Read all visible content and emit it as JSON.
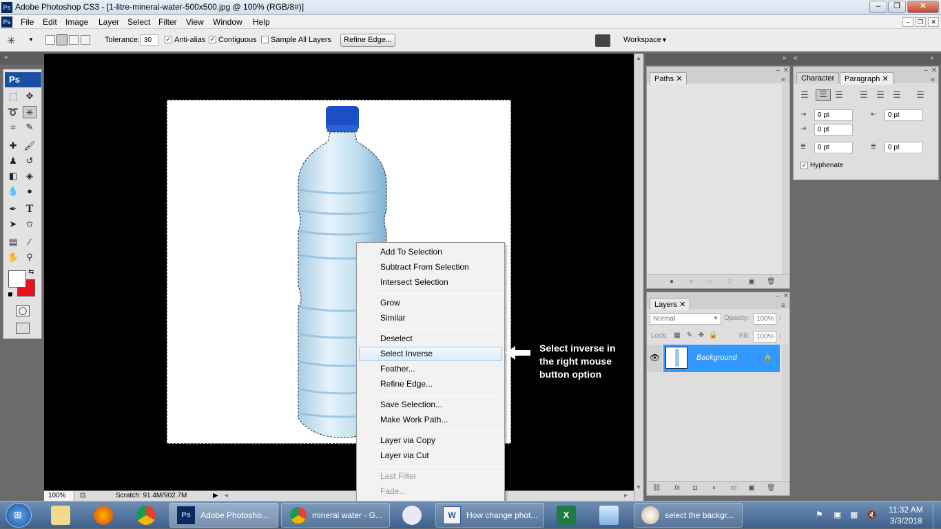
{
  "window": {
    "title": "Adobe Photoshop CS3 - [1-litre-mineral-water-500x500.jpg @ 100% (RGB/8#)]",
    "app_badge": "Ps"
  },
  "menubar": {
    "items": [
      "File",
      "Edit",
      "Image",
      "Layer",
      "Select",
      "Filter",
      "View",
      "Window",
      "Help"
    ]
  },
  "options": {
    "tolerance_label": "Tolerance:",
    "tolerance_value": "30",
    "anti_alias": "Anti-alias",
    "contiguous": "Contiguous",
    "sample_all_layers": "Sample All Layers",
    "refine_edge": "Refine Edge...",
    "workspace": "Workspace"
  },
  "toolbox": {
    "header": "Ps"
  },
  "context_menu": {
    "items": [
      {
        "label": "Add To Selection",
        "disabled": false
      },
      {
        "label": "Subtract From Selection",
        "disabled": false
      },
      {
        "label": "Intersect Selection",
        "disabled": false
      },
      {
        "label": "Grow",
        "disabled": false
      },
      {
        "label": "Similar",
        "disabled": false
      },
      {
        "label": "Deselect",
        "disabled": false
      },
      {
        "label": "Select Inverse",
        "disabled": false,
        "highlighted": true
      },
      {
        "label": "Feather...",
        "disabled": false
      },
      {
        "label": "Refine Edge...",
        "disabled": false
      },
      {
        "label": "Save Selection...",
        "disabled": false
      },
      {
        "label": "Make Work Path...",
        "disabled": false
      },
      {
        "label": "Layer via Copy",
        "disabled": false
      },
      {
        "label": "Layer via Cut",
        "disabled": false
      },
      {
        "label": "Last Filter",
        "disabled": true
      },
      {
        "label": "Fade...",
        "disabled": true
      }
    ]
  },
  "annotation": {
    "text": "Select inverse in the right mouse button option"
  },
  "status": {
    "zoom": "100%",
    "scratch": "Scratch: 91.4M/902.7M"
  },
  "paths_panel": {
    "tab": "Paths"
  },
  "paragraph_panel": {
    "tabs": [
      "Character",
      "Paragraph"
    ],
    "indent_left": "0 pt",
    "indent_right": "0 pt",
    "indent_first": "0 pt",
    "space_before": "0 pt",
    "space_after": "0 pt",
    "hyphenate": "Hyphenate"
  },
  "layers_panel": {
    "tab": "Layers",
    "blend_mode": "Normal",
    "opacity_label": "Opacity:",
    "opacity_value": "100%",
    "lock_label": "Lock:",
    "fill_label": "Fill:",
    "fill_value": "100%",
    "layer_name": "Background"
  },
  "taskbar": {
    "buttons": [
      "Adobe Photosho...",
      "mineral water - G...",
      "How change phot...",
      "select the backgr..."
    ],
    "time": "11:32 AM",
    "date": "3/3/2018"
  },
  "colors": {
    "accent": "#3399ff",
    "foreground_swatch": "#ffffff",
    "background_swatch": "#e8121b",
    "bottle_cap": "#1d4fc4"
  }
}
